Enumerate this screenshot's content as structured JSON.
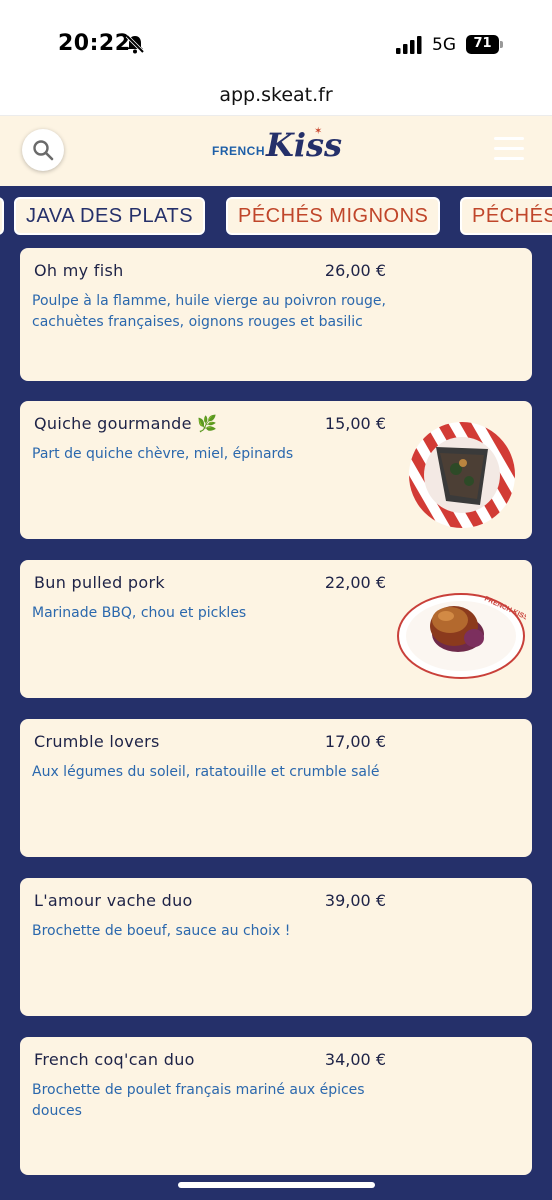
{
  "status": {
    "time": "20:22",
    "network": "5G",
    "battery": "71"
  },
  "browser": {
    "url": "app.skeat.fr"
  },
  "logo": {
    "word1": "FRENCH",
    "word2": "Kiss"
  },
  "categories": [
    {
      "label": "JAVA DES PLATS",
      "active": true
    },
    {
      "label": "PÉCHÉS MIGNONS",
      "active": false
    },
    {
      "label": "PÉCHÉS",
      "active": false
    }
  ],
  "dishes": [
    {
      "name": "Oh my fish",
      "price": "26,00 €",
      "description": "Poulpe à la flamme, huile vierge au poivron rouge, cachuètes françaises, oignons rouges et basilic",
      "photo": null
    },
    {
      "name": "Quiche gourmande 🌿",
      "price": "15,00 €",
      "description": "Part de quiche chèvre, miel, épinards",
      "photo": "quiche-plate"
    },
    {
      "name": "Bun pulled pork",
      "price": "22,00 €",
      "description": "Marinade BBQ, chou et pickles",
      "photo": "burger-plate"
    },
    {
      "name": "Crumble lovers",
      "price": "17,00 €",
      "description": "Aux légumes du soleil, ratatouille et crumble salé",
      "photo": null
    },
    {
      "name": "L'amour vache duo",
      "price": "39,00 €",
      "description": "Brochette de boeuf, sauce au choix !",
      "photo": null
    },
    {
      "name": "French coq'can duo",
      "price": "34,00 €",
      "description": "Brochette de poulet français mariné aux épices douces",
      "photo": null
    }
  ],
  "plate_text": "FRENCH KISS",
  "colors": {
    "navy": "#25306a",
    "cream": "#fdf4e3",
    "accent_red": "#c0462a",
    "desc_blue": "#2b68ad"
  }
}
